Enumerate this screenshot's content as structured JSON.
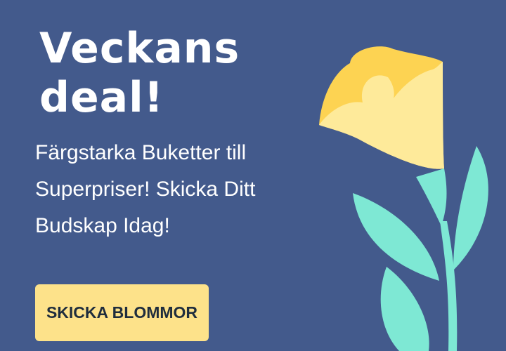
{
  "banner": {
    "headline_line1": "Veckans",
    "headline_line2": "deal!",
    "subtext": "Färgstarka Buketter till Superpriser! Skicka Ditt Budskap Idag!",
    "cta_label": "SKICKA BLOMMOR"
  },
  "colors": {
    "background": "#435a8c",
    "cta": "#fde28a",
    "petal_outer": "#fdd352",
    "petal_inner": "#feea9a",
    "stem": "#7ee8d4"
  },
  "decoration": {
    "icon": "tulip-flower-illustration"
  }
}
